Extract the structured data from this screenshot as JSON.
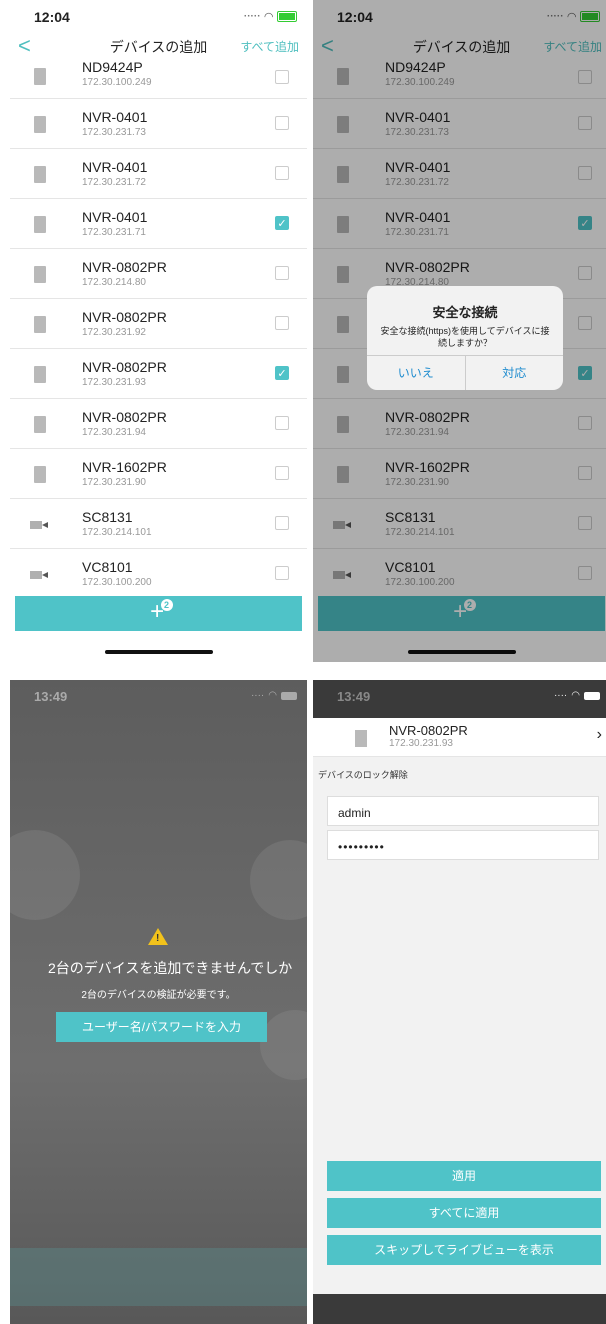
{
  "screen1": {
    "status": {
      "time": "12:04"
    },
    "nav": {
      "back": "<",
      "title": "デバイスの追加",
      "add_all": "すべて追加"
    },
    "devices": [
      {
        "name": "ND9424P",
        "ip": "172.30.100.249",
        "type": "nvr-icon",
        "checked": false
      },
      {
        "name": "NVR-0401",
        "ip": "172.30.231.73",
        "type": "nvr-icon",
        "checked": false
      },
      {
        "name": "NVR-0401",
        "ip": "172.30.231.72",
        "type": "nvr-icon",
        "checked": false
      },
      {
        "name": "NVR-0401",
        "ip": "172.30.231.71",
        "type": "nvr-icon",
        "checked": true
      },
      {
        "name": "NVR-0802PR",
        "ip": "172.30.214.80",
        "type": "nvr-icon",
        "checked": false
      },
      {
        "name": "NVR-0802PR",
        "ip": "172.30.231.92",
        "type": "nvr-icon",
        "checked": false
      },
      {
        "name": "NVR-0802PR",
        "ip": "172.30.231.93",
        "type": "nvr-icon",
        "checked": true
      },
      {
        "name": "NVR-0802PR",
        "ip": "172.30.231.94",
        "type": "nvr-icon",
        "checked": false
      },
      {
        "name": "NVR-1602PR",
        "ip": "172.30.231.90",
        "type": "nvr-icon",
        "checked": false
      },
      {
        "name": "SC8131",
        "ip": "172.30.214.101",
        "type": "camera-icon",
        "checked": false
      },
      {
        "name": "VC8101",
        "ip": "172.30.100.200",
        "type": "camera-icon",
        "checked": false
      }
    ],
    "add_button": {
      "icon": "+",
      "badge": "2"
    },
    "accent_color": "#4fc3c8"
  },
  "screen2": {
    "alert": {
      "title": "安全な接続",
      "message": "安全な接続(https)を使用してデバイスに接続しますか？",
      "no": "いいえ",
      "yes": "対応"
    }
  },
  "screen3": {
    "status": {
      "time": "13:49"
    },
    "title": "2台のデバイスを追加できませんでしか",
    "subtitle": "2台のデバイスの検証が必要です。",
    "button": "ユーザー名/パスワードを入力"
  },
  "screen4": {
    "status": {
      "time": "13:49"
    },
    "device": {
      "name": "NVR-0802PR",
      "ip": "172.30.231.93"
    },
    "section_label": "デバイスのロック解除",
    "username": "admin",
    "password": "•••••••••",
    "buttons": {
      "apply": "適用",
      "apply_all": "すべてに適用",
      "skip": "スキップしてライブビューを表示"
    }
  }
}
